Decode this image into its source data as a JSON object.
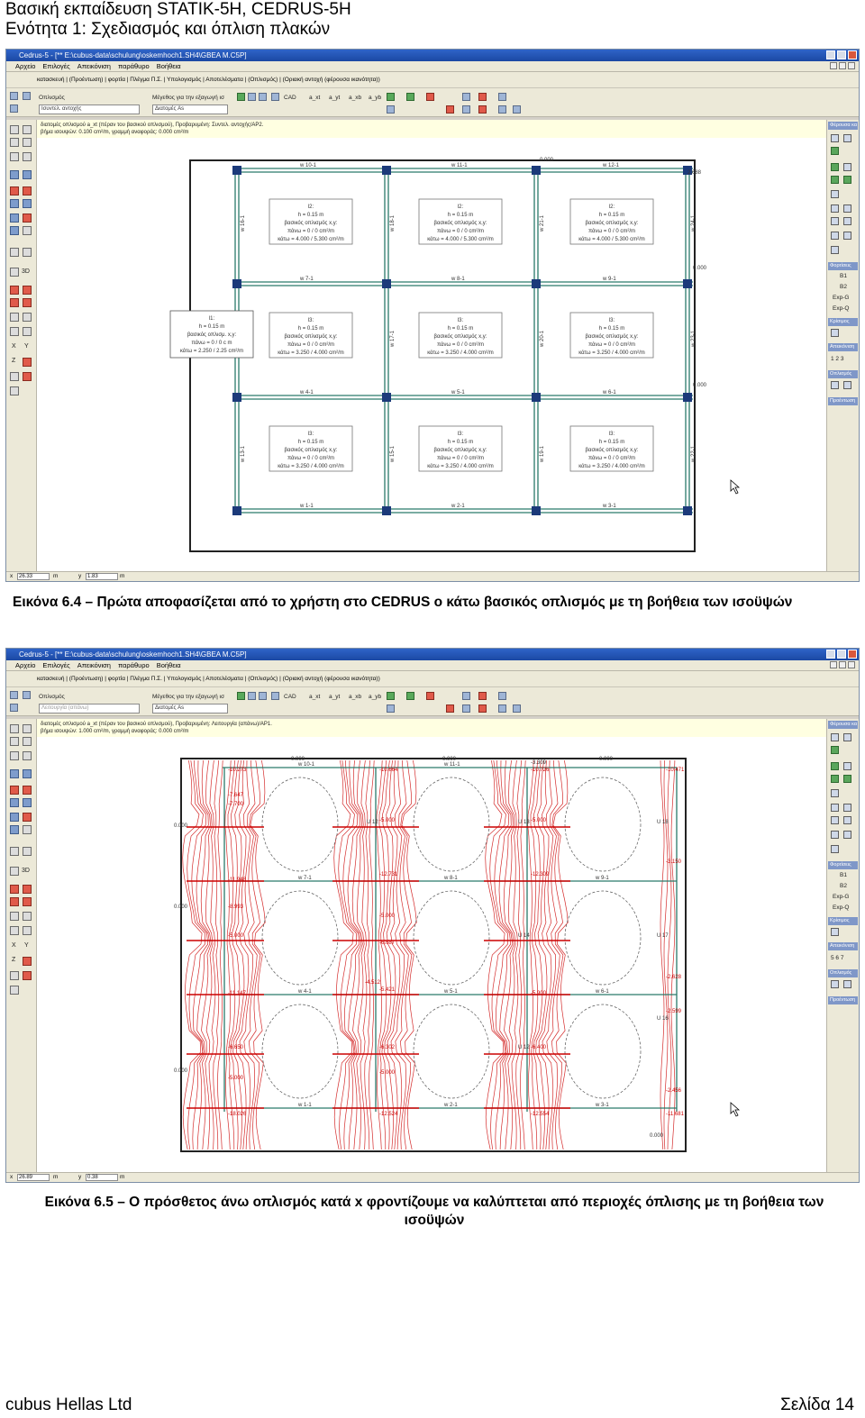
{
  "doc_header": {
    "line1": "Βασική εκπαίδευση STATIK-5H, CEDRUS-5H",
    "line2": "Ενότητα 1: Σχεδιασμός και όπλιση πλακών"
  },
  "app": {
    "title": "Cedrus-5 - [** E:\\cubus-data\\schulung\\oskemhoch1.SH4\\GBEA M.C5P]",
    "menu": [
      "Αρχείο",
      "Επιλογές",
      "Απεικόνιση",
      "παράθυρο",
      "Βοήθεια"
    ],
    "toolbar_tabs": "κατασκευή | (Προέντωση) | φορτία | Πλέγμα Π.Σ. | Υπολογισμός | Αποτελέσματα | (Οπλισμός) | (Οριακή αντοχή (φέρουσα ικανότητα))",
    "opl_label": "Οπλισμός",
    "size_label": "Μέγεθος για την εξαγωγή ισ",
    "size_value": "Διατομές As",
    "ax_labels": [
      "a_xt",
      "a_yt",
      "a_xb",
      "a_yb"
    ],
    "right_panel": {
      "head1": "Φέρουσα κα",
      "head2": "Φορτίσεις",
      "items": [
        "B1",
        "B2",
        "Exp-G",
        "Exp-Q"
      ],
      "head3": "Κρίσιμος",
      "head4": "Απεικόνιση",
      "head5": "Οπλισμός",
      "head6": "Προέντωση"
    },
    "left_labels": [
      "3D",
      "X",
      "Y",
      "Z"
    ]
  },
  "shot1": {
    "field_gray": "Ισυντελ. αντοχής",
    "info_line1": "διατομές οπλισμού a_xt (πέραν του βασικού οπλισμού), Προβαρυμένη: Συντελ. αντοχής/AP2.",
    "info_line2": "βήμα ισουψών: 0.100 cm²/m, γραμμή αναφοράς: 0.000 cm²/m",
    "status_x": "26.33",
    "status_y": "1.83",
    "status_unit": "m",
    "top_walls": [
      "w 10-1",
      "w 11-1",
      "w 12-1"
    ],
    "mid1_walls": [
      "w 7-1",
      "w 8-1",
      "w 9-1"
    ],
    "mid2_walls": [
      "w 4-1",
      "w 5-1",
      "w 6-1"
    ],
    "bot_walls": [
      "w 1-1",
      "w 2-1",
      "w 3-1"
    ],
    "vert_walls_row1": [
      "w 16-1",
      "w 18-1",
      "w 21-1",
      "w 24-1"
    ],
    "vert_walls_row2": [
      "w 14-1",
      "w 17-1",
      "w 20-1",
      "w 23-1"
    ],
    "vert_walls_row3": [
      "w 13-1",
      "w 15-1",
      "w 19-1",
      "w 22-1"
    ],
    "panel_row1": {
      "id": "l2:",
      "h": "h = 0.15 m",
      "l2": "βασικός οπλισμός x,y:",
      "l3": "πάνω = 0 / 0 cm²/m",
      "l4": "κάτω = 4.000 / 5.300 cm²/m"
    },
    "panel_row2": {
      "id": "l3:",
      "h": "h = 0.15 m",
      "l2": "βασικός οπλισμός x,y:",
      "l3": "πάνω = 0 / 0 cm²/m",
      "l4": "κάτω = 3.250 / 4.000 cm²/m"
    },
    "panel_row3": {
      "id": "l3:",
      "h": "h = 0.15 m",
      "l2": "βασικός οπλισμός x,y:",
      "l3": "πάνω = 0 / 0 cm²/m",
      "l4": "κάτω = 3.250 / 4.000 cm²/m"
    },
    "popup": {
      "id": "l1:",
      "h": "h = 0.15 m",
      "l2": "βασικός οπλισμ. x,y:",
      "l3": "πάνω = 0 / 0 c m",
      "l4": "κάτω = 2.250 / 2.25 cm²/m"
    },
    "value_labels": [
      "0.000",
      "2.688",
      "0.000",
      "0.000"
    ],
    "col_labels": [
      "13",
      "14",
      "15",
      "16",
      "12",
      "10",
      "9",
      "8",
      "4",
      "5",
      "6",
      "7",
      "B1",
      "B2",
      "B3",
      "B4"
    ]
  },
  "shot2": {
    "field_gray": "Λειτουργία (απάνω)",
    "info_line1": "διατομές οπλισμού a_xt (πέραν του βασικού οπλισμού), Προβαρυμένη: Λειτουργία (απάνω)/AP1.",
    "info_line2": "βήμα ισουψών: 1.000 cm²/m, γραμμή αναφοράς: 0.000 cm²/m",
    "status_x": "26.89",
    "status_y": "0.38",
    "status_unit": "m",
    "wall_labels": [
      "w 10-1",
      "w 11-1",
      "w 7-1",
      "w 8-1",
      "w 9-1",
      "w 4-1",
      "w 5-1",
      "w 6-1",
      "w 1-1",
      "w 2-1",
      "w 3-1"
    ],
    "top_values": [
      "0.000",
      "0.000",
      "0.000",
      "-3.309"
    ],
    "red_values": [
      "-10.273",
      "-10.664",
      "-10.726",
      "-10.471",
      "-7.647",
      "-7.700",
      "-5.000",
      "-5.000",
      "-11.948",
      "-12.731",
      "-12.309",
      "-8.993",
      "-5.000",
      "-5.000",
      "-6.687",
      "-11.147",
      "-4.512",
      "-5.421",
      "-5.900",
      "-6.650",
      "-6.302",
      "-6.400",
      "-5.000",
      "-5.000",
      "-18.026",
      "-12.524",
      "-12.554",
      "-11.681",
      "-3.150",
      "-2.628",
      "-2.599",
      "-2.456"
    ],
    "left_values": [
      "0.000",
      "0.000",
      "0.000"
    ],
    "u_labels": [
      "U 12",
      "U 13",
      "U 18",
      "U 14",
      "U 17",
      "U 16",
      "U 12"
    ],
    "bottom_value": "0.000"
  },
  "captions": {
    "cap1": "Εικόνα 6.4 – Πρώτα αποφασίζεται από το χρήστη στο CEDRUS ο κάτω βασικός οπλισμός με τη βοήθεια των ισοϋψών",
    "cap2_line1": "Εικόνα 6.5 – Ο πρόσθετος άνω οπλισμός κατά x φροντίζουμε να καλύπτεται από περιοχές όπλισης με τη βοήθεια των",
    "cap2_line2": "ισοϋψών"
  },
  "footer": {
    "left": "cubus Hellas Ltd",
    "right": "Σελίδα 14"
  }
}
